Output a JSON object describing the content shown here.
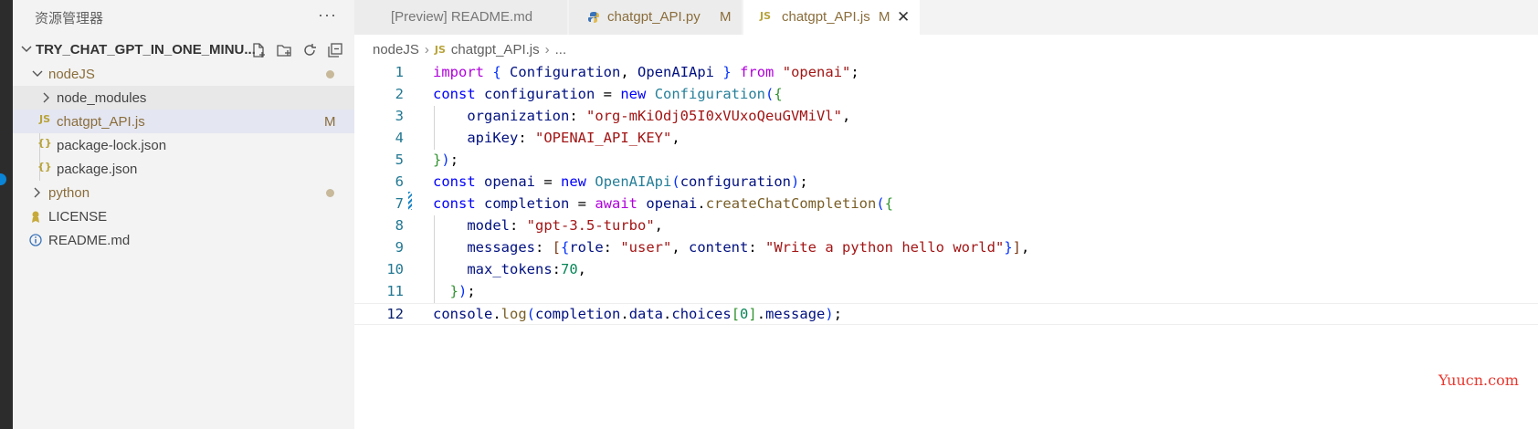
{
  "sidebar": {
    "title": "资源管理器",
    "root_label": "TRY_CHAT_GPT_IN_ONE_MINU...",
    "items": [
      {
        "label": "nodeJS",
        "status": "dot"
      },
      {
        "label": "node_modules"
      },
      {
        "label": "chatgpt_API.js",
        "status": "M",
        "icon": "JS"
      },
      {
        "label": "package-lock.json",
        "icon": "{}"
      },
      {
        "label": "package.json",
        "icon": "{}"
      },
      {
        "label": "python",
        "status": "dot"
      },
      {
        "label": "LICENSE"
      },
      {
        "label": "README.md"
      }
    ]
  },
  "tabs": [
    {
      "label": "[Preview] README.md"
    },
    {
      "label": "chatgpt_API.py",
      "modified": "M"
    },
    {
      "label": "chatgpt_API.js",
      "modified": "M",
      "icon": "JS"
    }
  ],
  "breadcrumb": {
    "folder": "nodeJS",
    "file": "chatgpt_API.js",
    "symbol": "...",
    "icon": "JS"
  },
  "editor": {
    "line_numbers": [
      "1",
      "2",
      "3",
      "4",
      "5",
      "6",
      "7",
      "8",
      "9",
      "10",
      "11",
      "12"
    ],
    "current_line": "12"
  },
  "watermark": "Yuucn.com",
  "colors": {
    "keyword": "#0000ff",
    "control": "#af00db",
    "string": "#a31515",
    "variable": "#001080",
    "type": "#267f99",
    "function": "#795e26",
    "number": "#098658"
  }
}
